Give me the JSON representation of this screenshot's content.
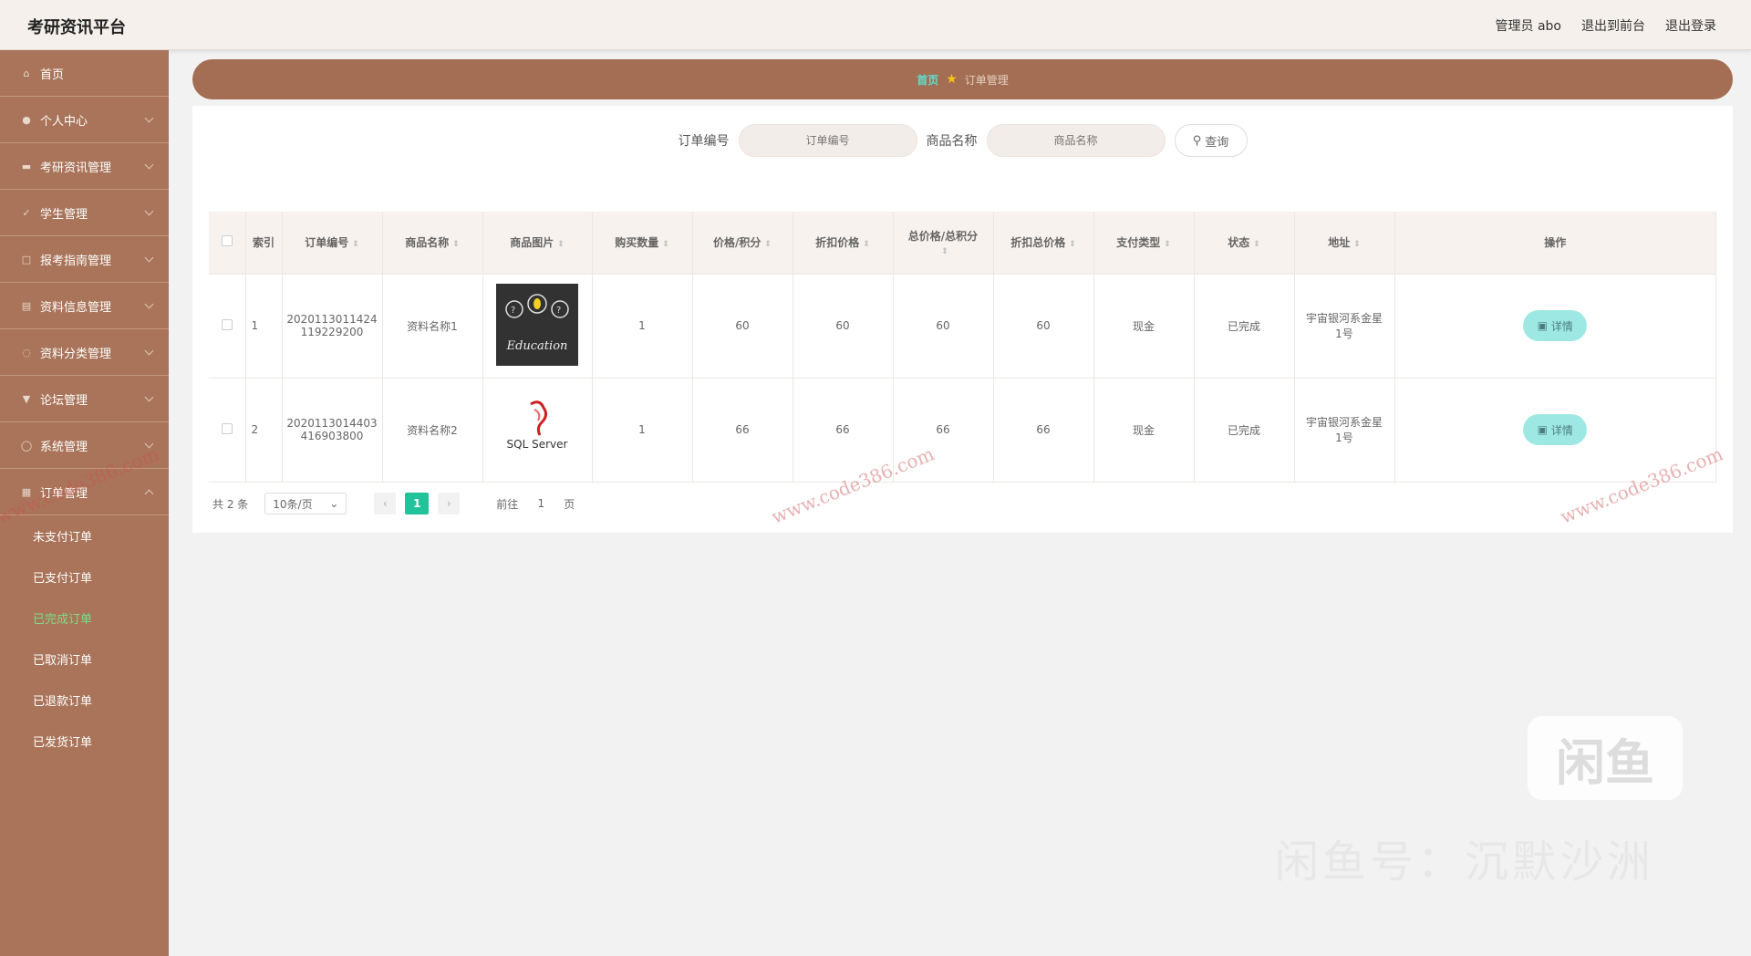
{
  "header": {
    "title": "考研资讯平台",
    "admin": "管理员 abo",
    "front": "退出到前台",
    "logout": "退出登录"
  },
  "sidebar": {
    "items": [
      {
        "label": "首页",
        "icon": "home-icon"
      },
      {
        "label": "个人中心",
        "icon": "user-icon"
      },
      {
        "label": "考研资讯管理",
        "icon": "news-icon"
      },
      {
        "label": "学生管理",
        "icon": "student-icon"
      },
      {
        "label": "报考指南管理",
        "icon": "guide-icon"
      },
      {
        "label": "资料信息管理",
        "icon": "info-icon"
      },
      {
        "label": "资料分类管理",
        "icon": "category-icon"
      },
      {
        "label": "论坛管理",
        "icon": "forum-icon"
      },
      {
        "label": "系统管理",
        "icon": "system-icon"
      },
      {
        "label": "订单管理",
        "icon": "order-icon"
      }
    ],
    "sub_items": [
      {
        "label": "未支付订单",
        "active": false
      },
      {
        "label": "已支付订单",
        "active": false
      },
      {
        "label": "已完成订单",
        "active": true
      },
      {
        "label": "已取消订单",
        "active": false
      },
      {
        "label": "已退款订单",
        "active": false
      },
      {
        "label": "已发货订单",
        "active": false
      }
    ]
  },
  "breadcrumb": {
    "home": "首页",
    "current": "订单管理"
  },
  "search": {
    "order_label": "订单编号",
    "order_placeholder": "订单编号",
    "goods_label": "商品名称",
    "goods_placeholder": "商品名称",
    "button": "查询"
  },
  "table": {
    "headers": [
      "索引",
      "订单编号",
      "商品名称",
      "商品图片",
      "购买数量",
      "价格/积分",
      "折扣价格",
      "总价格/总积分",
      "折扣总价格",
      "支付类型",
      "状态",
      "地址",
      "操作"
    ],
    "rows": [
      {
        "index": "1",
        "order_no_1": "2020113011424",
        "order_no_2": "119229200",
        "goods": "资料名称1",
        "image": "Education",
        "qty": "1",
        "price": "60",
        "discount": "60",
        "total": "60",
        "discount_total": "60",
        "pay": "现金",
        "status": "已完成",
        "addr_1": "宇宙银河系金星",
        "addr_2": "1号",
        "action": "详情"
      },
      {
        "index": "2",
        "order_no_1": "2020113014403",
        "order_no_2": "416903800",
        "goods": "资料名称2",
        "image": "SQL Server",
        "qty": "1",
        "price": "66",
        "discount": "66",
        "total": "66",
        "discount_total": "66",
        "pay": "现金",
        "status": "已完成",
        "addr_1": "宇宙银河系金星",
        "addr_2": "1号",
        "action": "详情"
      }
    ]
  },
  "pager": {
    "total": "共 2 条",
    "size": "10条/页",
    "page": "1",
    "goto": "前往",
    "goto_value": "1",
    "unit": "页"
  },
  "watermarks": {
    "site": "www.code386.com",
    "xianyu_logo": "闲鱼",
    "xianyu_text": "闲鱼号：沉默沙洲"
  }
}
